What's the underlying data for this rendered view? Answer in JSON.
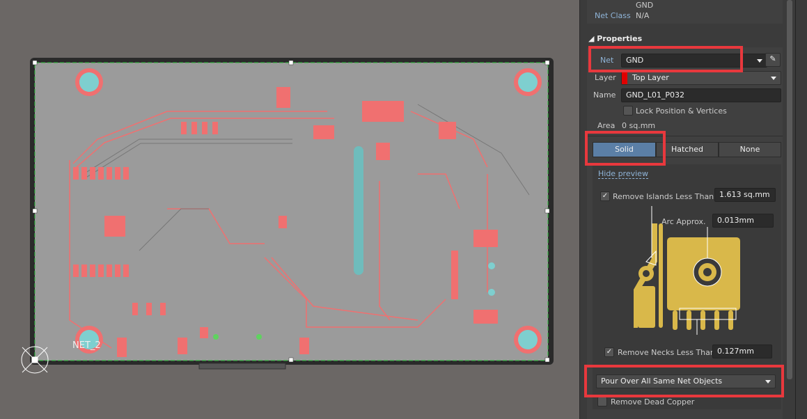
{
  "board": {
    "designator_label": "NET_2",
    "colors": {
      "board_fill": "#9b9b9b",
      "copper": "#f07070",
      "hole": "#7ecfcf",
      "outline": "#2a2a2a"
    }
  },
  "panel": {
    "net_info": {
      "net_value_cut": "GND",
      "net_class_label": "Net Class",
      "net_class_value": "N/A"
    },
    "properties": {
      "title": "Properties",
      "net_label": "Net",
      "net_value": "GND",
      "layer_label": "Layer",
      "layer_value": "Top Layer",
      "layer_color": "#e00000",
      "name_label": "Name",
      "name_value": "GND_L01_P032",
      "lock_label": "Lock Position & Vertices",
      "lock_checked": false,
      "area_label": "Area",
      "area_value": "0 sq.mm",
      "fill_modes": [
        "Solid",
        "Hatched",
        "None"
      ],
      "fill_mode_selected": "Solid",
      "hide_preview": "Hide preview",
      "remove_islands_label": "Remove Islands Less Than",
      "remove_islands_checked": true,
      "remove_islands_value": "1.613 sq.mm",
      "arc_approx_label": "Arc Approx.",
      "arc_approx_value": "0.013mm",
      "remove_necks_label": "Remove Necks Less Than",
      "remove_necks_checked": true,
      "remove_necks_value": "0.127mm",
      "pour_over_value": "Pour Over All Same Net Objects",
      "remove_dead_copper_label": "Remove Dead Copper",
      "remove_dead_copper_checked": false,
      "check_glyph": "✓"
    },
    "highlight_color": "#e8383d"
  }
}
